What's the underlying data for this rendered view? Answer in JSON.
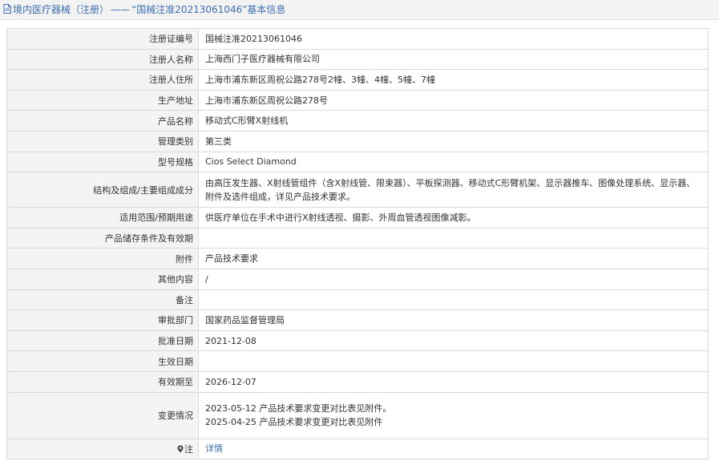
{
  "header": {
    "title_prefix": "境内医疗器械（注册）",
    "separator": "——",
    "title_suffix": "“国械注准20213061046”基本信息"
  },
  "rows": [
    {
      "label": "注册证编号",
      "value": "国械注准20213061046"
    },
    {
      "label": "注册人名称",
      "value": "上海西门子医疗器械有限公司"
    },
    {
      "label": "注册人住所",
      "value": "上海市浦东新区周祝公路278号2幢、3幢、4幢、5幢、7幢"
    },
    {
      "label": "生产地址",
      "value": "上海市浦东新区周祝公路278号"
    },
    {
      "label": "产品名称",
      "value": "移动式C形臂X射线机"
    },
    {
      "label": "管理类别",
      "value": "第三类"
    },
    {
      "label": "型号规格",
      "value": "Cios Select Diamond"
    },
    {
      "label": "结构及组成/主要组成成分",
      "value": "由高压发生器、X射线管组件（含X射线管、限束器）、平板探测器、移动式C形臂机架、显示器推车、图像处理系统、显示器、附件及选件组成，详见产品技术要求。"
    },
    {
      "label": "适用范围/预期用途",
      "value": "供医疗单位在手术中进行X射线透视、摄影、外周血管透视图像减影。"
    },
    {
      "label": "产品储存条件及有效期",
      "value": ""
    },
    {
      "label": "附件",
      "value": "产品技术要求"
    },
    {
      "label": "其他内容",
      "value": "/"
    },
    {
      "label": "备注",
      "value": ""
    },
    {
      "label": "审批部门",
      "value": "国家药品监督管理局"
    },
    {
      "label": "批准日期",
      "value": "2021-12-08"
    },
    {
      "label": "生效日期",
      "value": ""
    },
    {
      "label": "有效期至",
      "value": "2026-12-07"
    }
  ],
  "changes": {
    "label": "变更情况",
    "lines": [
      "2023-05-12 产品技术要求变更对比表见附件。",
      "2025-04-25 产品技术要求变更对比表见附件"
    ]
  },
  "note": {
    "label": "注",
    "link_text": "详情"
  },
  "colors": {
    "link": "#3c6eb4",
    "label_bg": "#f4f4f4",
    "border": "#d9d9d9"
  }
}
